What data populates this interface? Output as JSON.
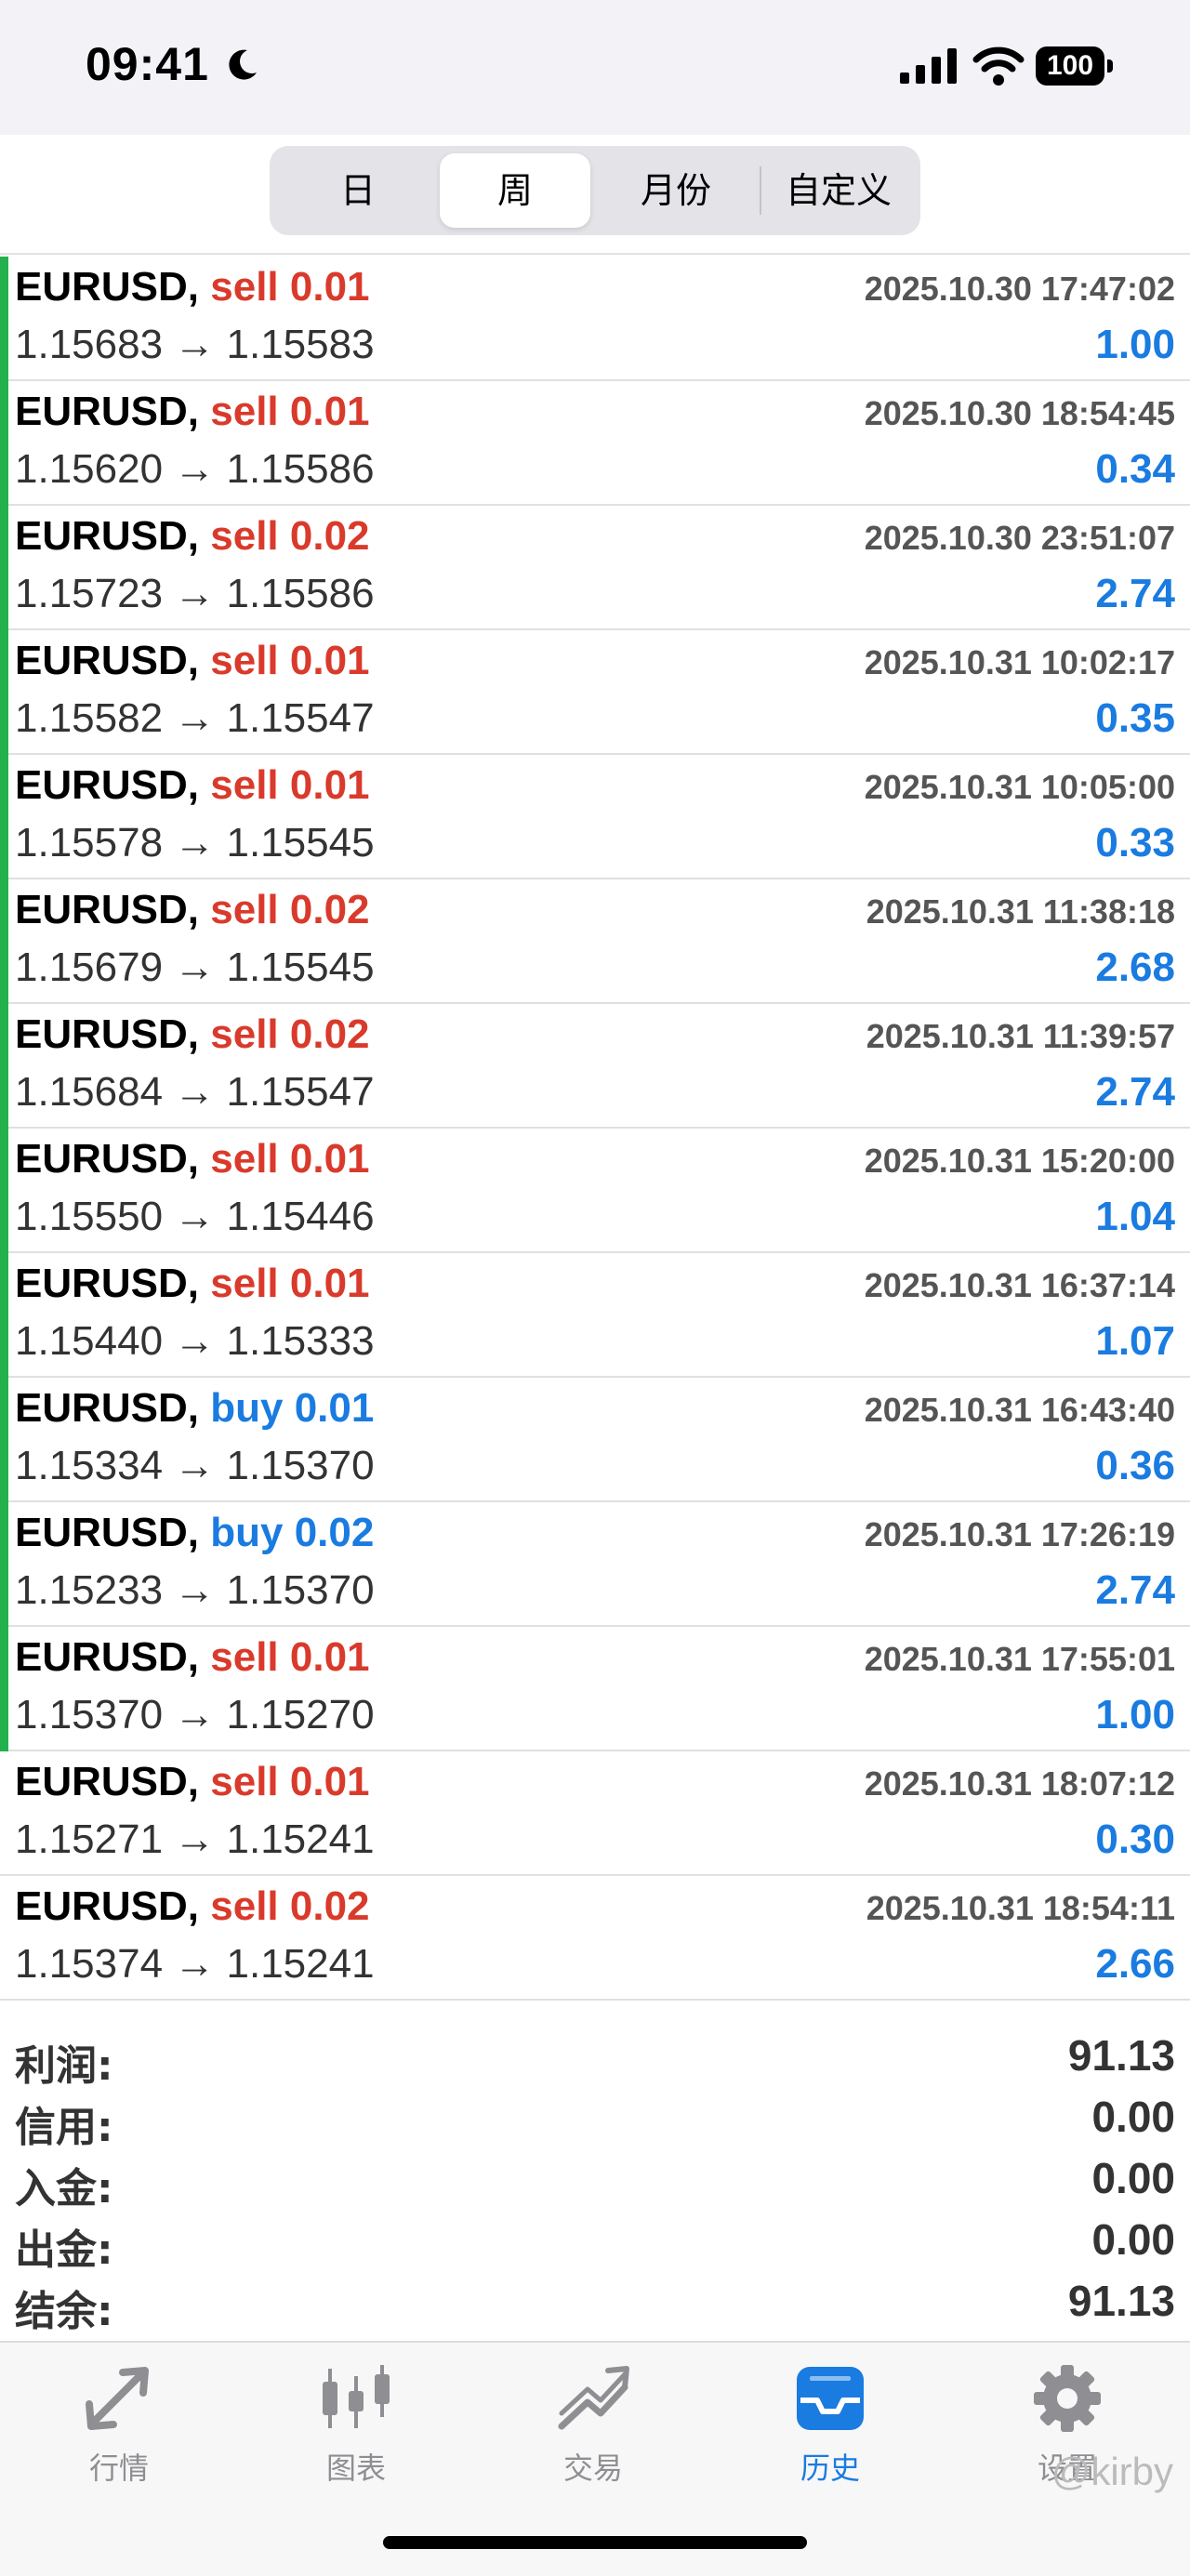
{
  "status_bar": {
    "time": "09:41",
    "battery": "100"
  },
  "segments": [
    "日",
    "周",
    "月份",
    "自定义"
  ],
  "active_segment": "周",
  "trades": [
    {
      "symbol": "EURUSD,",
      "action": "sell",
      "volume": "sell 0.01",
      "prices": "1.15683 → 1.15583",
      "time": "2025.10.30 17:47:02",
      "profit": "1.00",
      "marker": true
    },
    {
      "symbol": "EURUSD,",
      "action": "sell",
      "volume": "sell 0.01",
      "prices": "1.15620 → 1.15586",
      "time": "2025.10.30 18:54:45",
      "profit": "0.34",
      "marker": true
    },
    {
      "symbol": "EURUSD,",
      "action": "sell",
      "volume": "sell 0.02",
      "prices": "1.15723 → 1.15586",
      "time": "2025.10.30 23:51:07",
      "profit": "2.74",
      "marker": true
    },
    {
      "symbol": "EURUSD,",
      "action": "sell",
      "volume": "sell 0.01",
      "prices": "1.15582 → 1.15547",
      "time": "2025.10.31 10:02:17",
      "profit": "0.35",
      "marker": true
    },
    {
      "symbol": "EURUSD,",
      "action": "sell",
      "volume": "sell 0.01",
      "prices": "1.15578 → 1.15545",
      "time": "2025.10.31 10:05:00",
      "profit": "0.33",
      "marker": true
    },
    {
      "symbol": "EURUSD,",
      "action": "sell",
      "volume": "sell 0.02",
      "prices": "1.15679 → 1.15545",
      "time": "2025.10.31 11:38:18",
      "profit": "2.68",
      "marker": true
    },
    {
      "symbol": "EURUSD,",
      "action": "sell",
      "volume": "sell 0.02",
      "prices": "1.15684 → 1.15547",
      "time": "2025.10.31 11:39:57",
      "profit": "2.74",
      "marker": true
    },
    {
      "symbol": "EURUSD,",
      "action": "sell",
      "volume": "sell 0.01",
      "prices": "1.15550 → 1.15446",
      "time": "2025.10.31 15:20:00",
      "profit": "1.04",
      "marker": true
    },
    {
      "symbol": "EURUSD,",
      "action": "sell",
      "volume": "sell 0.01",
      "prices": "1.15440 → 1.15333",
      "time": "2025.10.31 16:37:14",
      "profit": "1.07",
      "marker": true
    },
    {
      "symbol": "EURUSD,",
      "action": "buy",
      "volume": "buy 0.01",
      "prices": "1.15334 → 1.15370",
      "time": "2025.10.31 16:43:40",
      "profit": "0.36",
      "marker": true
    },
    {
      "symbol": "EURUSD,",
      "action": "buy",
      "volume": "buy 0.02",
      "prices": "1.15233 → 1.15370",
      "time": "2025.10.31 17:26:19",
      "profit": "2.74",
      "marker": true
    },
    {
      "symbol": "EURUSD,",
      "action": "sell",
      "volume": "sell 0.01",
      "prices": "1.15370 → 1.15270",
      "time": "2025.10.31 17:55:01",
      "profit": "1.00",
      "marker": true
    },
    {
      "symbol": "EURUSD,",
      "action": "sell",
      "volume": "sell 0.01",
      "prices": "1.15271 → 1.15241",
      "time": "2025.10.31 18:07:12",
      "profit": "0.30",
      "marker": false
    },
    {
      "symbol": "EURUSD,",
      "action": "sell",
      "volume": "sell 0.02",
      "prices": "1.15374 → 1.15241",
      "time": "2025.10.31 18:54:11",
      "profit": "2.66",
      "marker": false
    }
  ],
  "summary": [
    {
      "label": "利润:",
      "value": "91.13"
    },
    {
      "label": "信用:",
      "value": "0.00"
    },
    {
      "label": "入金:",
      "value": "0.00"
    },
    {
      "label": "出金:",
      "value": "0.00"
    },
    {
      "label": "结余:",
      "value": "91.13"
    }
  ],
  "tabs": [
    {
      "label": "行情",
      "icon": "quotes-arrows-icon"
    },
    {
      "label": "图表",
      "icon": "candlestick-chart-icon"
    },
    {
      "label": "交易",
      "icon": "trade-trend-icon"
    },
    {
      "label": "历史",
      "icon": "history-inbox-icon"
    },
    {
      "label": "设置",
      "icon": "gear-icon"
    }
  ],
  "active_tab": "历史",
  "watermark": "@kirby",
  "colors": {
    "sell": "#d93a2b",
    "buy": "#1a7be0",
    "profit": "#1a7be0",
    "marker_green": "#22b14c",
    "tab_active": "#1a7be0",
    "tab_inactive": "#8e8e93"
  }
}
